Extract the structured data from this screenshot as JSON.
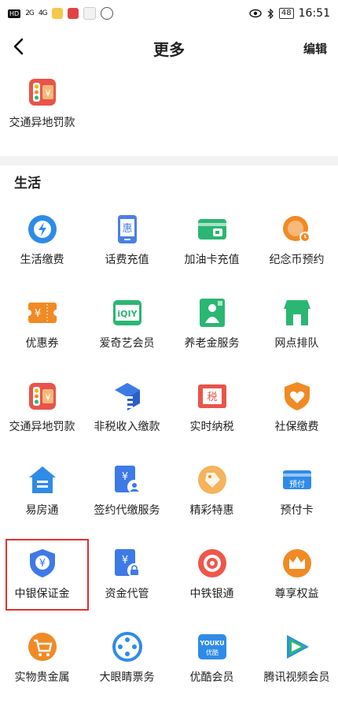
{
  "status_bar": {
    "hd_badge": "HD",
    "sig1": "2G",
    "sig2": "4G",
    "battery": "48",
    "time": "16:51"
  },
  "header": {
    "title": "更多",
    "edit_label": "编辑"
  },
  "top_items": [
    {
      "label": "交通异地罚款",
      "icon": "traffic-fine-icon"
    }
  ],
  "section_title": "生活",
  "grid": [
    {
      "label": "生活缴费",
      "icon": "utility-bill-icon"
    },
    {
      "label": "话费充值",
      "icon": "phone-recharge-icon"
    },
    {
      "label": "加油卡充值",
      "icon": "fuel-card-icon"
    },
    {
      "label": "纪念币预约",
      "icon": "coin-booking-icon"
    },
    {
      "label": "优惠券",
      "icon": "coupon-icon"
    },
    {
      "label": "爱奇艺会员",
      "icon": "iqiyi-icon"
    },
    {
      "label": "养老金服务",
      "icon": "pension-icon"
    },
    {
      "label": "网点排队",
      "icon": "branch-queue-icon"
    },
    {
      "label": "交通异地罚款",
      "icon": "traffic-fine-icon"
    },
    {
      "label": "非税收入缴款",
      "icon": "nontax-payment-icon"
    },
    {
      "label": "实时纳税",
      "icon": "tax-icon"
    },
    {
      "label": "社保缴费",
      "icon": "social-security-icon"
    },
    {
      "label": "易房通",
      "icon": "house-icon"
    },
    {
      "label": "签约代缴服务",
      "icon": "contract-payment-icon"
    },
    {
      "label": "精彩特惠",
      "icon": "deals-tag-icon"
    },
    {
      "label": "预付卡",
      "icon": "prepaid-card-icon"
    },
    {
      "label": "中银保证金",
      "icon": "boc-deposit-shield-icon"
    },
    {
      "label": "资金代管",
      "icon": "fund-custody-icon"
    },
    {
      "label": "中铁银通",
      "icon": "railway-card-icon"
    },
    {
      "label": "尊享权益",
      "icon": "crown-icon"
    },
    {
      "label": "实物贵金属",
      "icon": "precious-metal-cart-icon"
    },
    {
      "label": "大眼睛票务",
      "icon": "film-reel-icon"
    },
    {
      "label": "优酷会员",
      "icon": "youku-icon"
    },
    {
      "label": "腾讯视频会员",
      "icon": "tencent-video-icon"
    }
  ],
  "icon_texts": {
    "hui": "惠",
    "iqiyi": "iQIY",
    "tax": "税",
    "prepaid": "预付",
    "youku": "YOUKU",
    "youku_cn": "优酷",
    "yen": "¥"
  },
  "colors": {
    "blue": "#2f6fe0",
    "orange": "#f08a24",
    "red": "#e9534a",
    "green": "#2bb673",
    "highlight": "#e0312e"
  }
}
